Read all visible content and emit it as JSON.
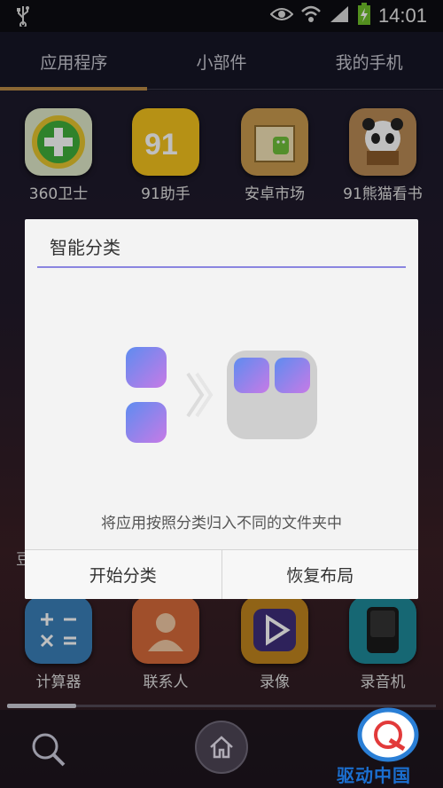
{
  "status_bar": {
    "usb_icon": "usb-icon",
    "time": "14:01"
  },
  "tabs": [
    {
      "label": "应用程序",
      "active": true
    },
    {
      "label": "小部件",
      "active": false
    },
    {
      "label": "我的手机",
      "active": false
    }
  ],
  "apps_top": [
    {
      "label": "360卫士",
      "icon": "360-security-icon"
    },
    {
      "label": "91助手",
      "icon": "91-assistant-icon"
    },
    {
      "label": "安卓市场",
      "icon": "android-market-icon"
    },
    {
      "label": "91熊猫看书",
      "icon": "panda-reader-icon"
    }
  ],
  "apps_bottom": [
    {
      "label": "计算器",
      "icon": "calculator-icon"
    },
    {
      "label": "联系人",
      "icon": "contacts-icon"
    },
    {
      "label": "录像",
      "icon": "video-recorder-icon"
    },
    {
      "label": "录音机",
      "icon": "sound-recorder-icon"
    }
  ],
  "partial_label": "豆",
  "dialog": {
    "title": "智能分类",
    "description": "将应用按照分类归入不同的文件夹中",
    "start_button": "开始分类",
    "restore_button": "恢复布局"
  },
  "dock": {
    "search_icon": "search-icon",
    "home_icon": "home-icon"
  },
  "watermark": "驱动中国",
  "colors": {
    "accent": "#8a85e0",
    "tab_indicator": "#b98a46"
  }
}
